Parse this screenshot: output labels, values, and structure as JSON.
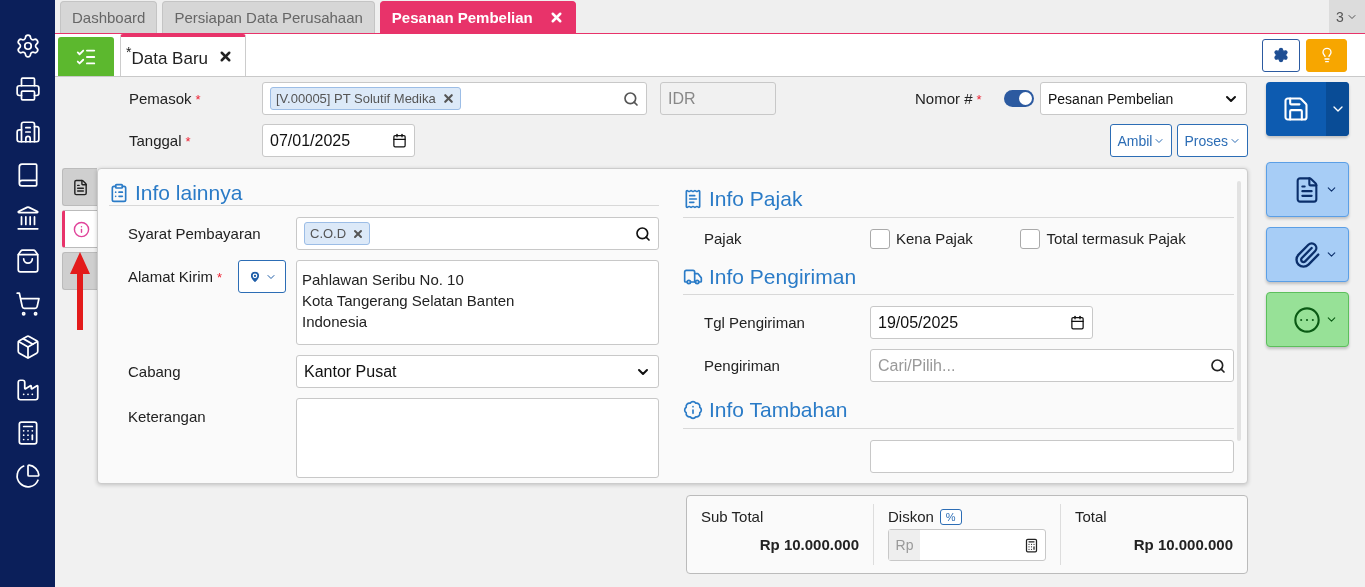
{
  "required_mark": "*",
  "tabs": [
    {
      "label": "Dashboard",
      "selected": false,
      "closable": false
    },
    {
      "label": "Persiapan Data Perusahaan",
      "selected": false,
      "closable": false
    },
    {
      "label": "Pesanan Pembelian",
      "selected": true,
      "closable": true
    }
  ],
  "tab_count": "3",
  "doc_tabs": [
    {
      "label": "Data Baru",
      "modified_mark": "*",
      "selected": true
    }
  ],
  "header": {
    "pemasok": {
      "label": "Pemasok",
      "required": true,
      "tag": "[V.00005] PT Solutif Medika"
    },
    "currency": {
      "value": "IDR"
    },
    "tanggal": {
      "label": "Tanggal",
      "required": true,
      "value": "07/01/2025"
    },
    "nomor": {
      "label": "Nomor #",
      "required": true,
      "auto": true,
      "value": "Pesanan Pembelian"
    },
    "buttons": [
      "Ambil",
      "Proses"
    ]
  },
  "side_tabs": [
    {
      "kind": "document",
      "selected": false
    },
    {
      "kind": "info",
      "selected": true
    },
    {
      "kind": "blank",
      "selected": false
    }
  ],
  "panel": {
    "left": {
      "title": "Info lainnya",
      "fields": [
        {
          "kind": "tags",
          "label": "Syarat Pembayaran",
          "tags": [
            "C.O.D"
          ]
        },
        {
          "kind": "address",
          "label": "Alamat Kirim",
          "required": true,
          "lines": [
            "Pahlawan Seribu No. 10",
            "Kota Tangerang Selatan Banten",
            "Indonesia"
          ]
        },
        {
          "kind": "select",
          "label": "Cabang",
          "value": "Kantor Pusat"
        },
        {
          "kind": "textarea",
          "label": "Keterangan"
        }
      ]
    },
    "right": [
      {
        "title": "Info Pajak",
        "rows": [
          {
            "kind": "checks",
            "label": "Pajak",
            "options": [
              {
                "label": "Kena Pajak",
                "checked": false
              },
              {
                "label": "Total termasuk Pajak",
                "checked": false
              }
            ]
          }
        ]
      },
      {
        "title": "Info Pengiriman",
        "rows": [
          {
            "kind": "date",
            "label": "Tgl Pengiriman",
            "value": "19/05/2025"
          },
          {
            "kind": "search",
            "label": "Pengiriman",
            "placeholder": "Cari/Pilih..."
          }
        ]
      },
      {
        "title": "Info Tambahan",
        "rows": [
          {
            "kind": "partial"
          }
        ]
      }
    ]
  },
  "summary": {
    "subtotal": {
      "label": "Sub Total",
      "value": "Rp 10.000.000"
    },
    "discount": {
      "label": "Diskon",
      "mode": "%",
      "prefix": "Rp"
    },
    "total": {
      "label": "Total",
      "value": "Rp 10.000.000"
    }
  }
}
